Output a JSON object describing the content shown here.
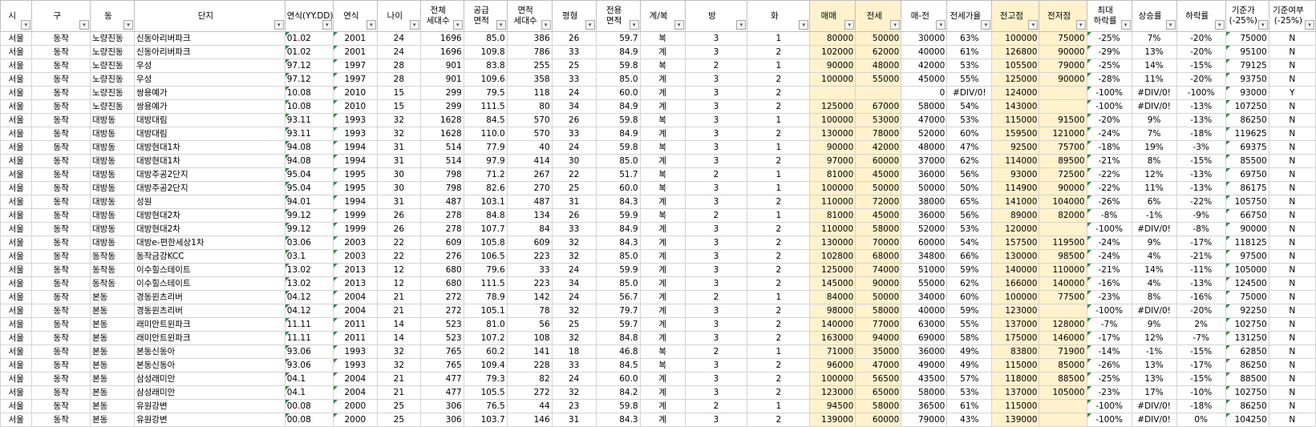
{
  "headers": [
    "시",
    "구",
    "동",
    "단지",
    "연식(YY.DD)",
    "연식",
    "나이",
    "전체\n세대수",
    "공급\n면적",
    "면적\n세대수",
    "평형",
    "전용\n면적",
    "계/복",
    "방",
    "화",
    "매매",
    "전세",
    "매-전",
    "전세가율",
    "전고점",
    "전저점",
    "최대\n하락률",
    "상승률",
    "하락률",
    "기준가\n(-25%)",
    "기준여부\n(-25%)"
  ],
  "rows": [
    [
      "서울",
      "동작",
      "노량진동",
      "신동아리버파크",
      "01.02",
      "2001",
      "24",
      "1696",
      "85.0",
      "386",
      "26",
      "59.7",
      "복",
      "3",
      "1",
      "80000",
      "50000",
      "30000",
      "63%",
      "100000",
      "75000",
      "-25%",
      "7%",
      "-20%",
      "75000",
      "N"
    ],
    [
      "서울",
      "동작",
      "노량진동",
      "신동아리버파크",
      "01.02",
      "2001",
      "24",
      "1696",
      "109.8",
      "786",
      "33",
      "84.9",
      "계",
      "3",
      "2",
      "102000",
      "62000",
      "40000",
      "61%",
      "126800",
      "90000",
      "-29%",
      "13%",
      "-20%",
      "95100",
      "N"
    ],
    [
      "서울",
      "동작",
      "노량진동",
      "우성",
      "97.12",
      "1997",
      "28",
      "901",
      "83.8",
      "255",
      "25",
      "59.8",
      "복",
      "2",
      "1",
      "90000",
      "48000",
      "42000",
      "53%",
      "105500",
      "79000",
      "-25%",
      "14%",
      "-15%",
      "79125",
      "N"
    ],
    [
      "서울",
      "동작",
      "노량진동",
      "우성",
      "97.12",
      "1997",
      "28",
      "901",
      "109.6",
      "358",
      "33",
      "85.0",
      "계",
      "3",
      "2",
      "100000",
      "55000",
      "45000",
      "55%",
      "125000",
      "90000",
      "-28%",
      "11%",
      "-20%",
      "93750",
      "N"
    ],
    [
      "서울",
      "동작",
      "노량진동",
      "쌍용예가",
      "10.08",
      "2010",
      "15",
      "299",
      "79.5",
      "118",
      "24",
      "60.0",
      "계",
      "3",
      "2",
      "",
      "",
      "0",
      "#DIV/0!",
      "124000",
      "",
      "-100%",
      "#DIV/0!",
      "-100%",
      "93000",
      "Y"
    ],
    [
      "서울",
      "동작",
      "노량진동",
      "쌍용예가",
      "10.08",
      "2010",
      "15",
      "299",
      "111.5",
      "80",
      "34",
      "84.9",
      "계",
      "3",
      "2",
      "125000",
      "67000",
      "58000",
      "54%",
      "143000",
      "",
      "-100%",
      "#DIV/0!",
      "-13%",
      "107250",
      "N"
    ],
    [
      "서울",
      "동작",
      "대방동",
      "대방대림",
      "93.11",
      "1993",
      "32",
      "1628",
      "84.5",
      "570",
      "26",
      "59.8",
      "복",
      "3",
      "1",
      "100000",
      "53000",
      "47000",
      "53%",
      "115000",
      "91500",
      "-20%",
      "9%",
      "-13%",
      "86250",
      "N"
    ],
    [
      "서울",
      "동작",
      "대방동",
      "대방대림",
      "93.11",
      "1993",
      "32",
      "1628",
      "110.0",
      "570",
      "33",
      "84.9",
      "계",
      "3",
      "2",
      "130000",
      "78000",
      "52000",
      "60%",
      "159500",
      "121000",
      "-24%",
      "7%",
      "-18%",
      "119625",
      "N"
    ],
    [
      "서울",
      "동작",
      "대방동",
      "대방현대1차",
      "94.08",
      "1994",
      "31",
      "514",
      "77.9",
      "40",
      "24",
      "59.8",
      "복",
      "3",
      "1",
      "90000",
      "42000",
      "48000",
      "47%",
      "92500",
      "75700",
      "-18%",
      "19%",
      "-3%",
      "69375",
      "N"
    ],
    [
      "서울",
      "동작",
      "대방동",
      "대방현대1차",
      "94.08",
      "1994",
      "31",
      "514",
      "97.9",
      "414",
      "30",
      "85.0",
      "계",
      "3",
      "2",
      "97000",
      "60000",
      "37000",
      "62%",
      "114000",
      "89500",
      "-21%",
      "8%",
      "-15%",
      "85500",
      "N"
    ],
    [
      "서울",
      "동작",
      "대방동",
      "대방주공2단지",
      "95.04",
      "1995",
      "30",
      "798",
      "71.2",
      "267",
      "22",
      "51.7",
      "복",
      "2",
      "1",
      "81000",
      "45000",
      "36000",
      "56%",
      "93000",
      "72500",
      "-22%",
      "12%",
      "-13%",
      "69750",
      "N"
    ],
    [
      "서울",
      "동작",
      "대방동",
      "대방주공2단지",
      "95.04",
      "1995",
      "30",
      "798",
      "82.6",
      "270",
      "25",
      "60.0",
      "복",
      "3",
      "1",
      "100000",
      "50000",
      "50000",
      "50%",
      "114900",
      "90000",
      "-22%",
      "11%",
      "-13%",
      "86175",
      "N"
    ],
    [
      "서울",
      "동작",
      "대방동",
      "성원",
      "94.01",
      "1994",
      "31",
      "487",
      "103.1",
      "487",
      "31",
      "84.3",
      "계",
      "3",
      "2",
      "110000",
      "72000",
      "38000",
      "65%",
      "141000",
      "104000",
      "-26%",
      "6%",
      "-22%",
      "105750",
      "N"
    ],
    [
      "서울",
      "동작",
      "대방동",
      "대방현대2차",
      "99.12",
      "1999",
      "26",
      "278",
      "84.8",
      "134",
      "26",
      "59.9",
      "복",
      "2",
      "1",
      "81000",
      "45000",
      "36000",
      "56%",
      "89000",
      "82000",
      "-8%",
      "-1%",
      "-9%",
      "66750",
      "N"
    ],
    [
      "서울",
      "동작",
      "대방동",
      "대방현대2차",
      "99.12",
      "1999",
      "26",
      "278",
      "107.7",
      "84",
      "33",
      "84.9",
      "계",
      "3",
      "2",
      "110000",
      "58000",
      "52000",
      "53%",
      "120000",
      "",
      "-100%",
      "#DIV/0!",
      "-8%",
      "90000",
      "N"
    ],
    [
      "서울",
      "동작",
      "대방동",
      "대방e-편한세상1차",
      "03.06",
      "2003",
      "22",
      "609",
      "105.8",
      "609",
      "32",
      "84.3",
      "계",
      "3",
      "2",
      "130000",
      "70000",
      "60000",
      "54%",
      "157500",
      "119500",
      "-24%",
      "9%",
      "-17%",
      "118125",
      "N"
    ],
    [
      "서울",
      "동작",
      "동작동",
      "동작금강KCC",
      "03.1",
      "2003",
      "22",
      "276",
      "106.5",
      "223",
      "32",
      "85.0",
      "계",
      "3",
      "2",
      "102800",
      "68000",
      "34800",
      "66%",
      "130000",
      "98500",
      "-24%",
      "4%",
      "-21%",
      "97500",
      "N"
    ],
    [
      "서울",
      "동작",
      "동작동",
      "이수힐스테이트",
      "13.02",
      "2013",
      "12",
      "680",
      "79.6",
      "33",
      "24",
      "59.9",
      "계",
      "3",
      "2",
      "125000",
      "74000",
      "51000",
      "59%",
      "140000",
      "110000",
      "-21%",
      "14%",
      "-11%",
      "105000",
      "N"
    ],
    [
      "서울",
      "동작",
      "동작동",
      "이수힐스테이트",
      "13.02",
      "2013",
      "12",
      "680",
      "111.5",
      "223",
      "34",
      "85.0",
      "계",
      "3",
      "2",
      "145000",
      "90000",
      "55000",
      "62%",
      "166000",
      "140000",
      "-16%",
      "4%",
      "-13%",
      "124500",
      "N"
    ],
    [
      "서울",
      "동작",
      "본동",
      "경동윈츠리버",
      "04.12",
      "2004",
      "21",
      "272",
      "78.9",
      "142",
      "24",
      "56.7",
      "계",
      "2",
      "1",
      "84000",
      "50000",
      "34000",
      "60%",
      "100000",
      "77500",
      "-23%",
      "8%",
      "-16%",
      "75000",
      "N"
    ],
    [
      "서울",
      "동작",
      "본동",
      "경동윈츠리버",
      "04.12",
      "2004",
      "21",
      "272",
      "105.1",
      "78",
      "32",
      "79.7",
      "계",
      "3",
      "2",
      "98000",
      "58000",
      "40000",
      "59%",
      "123000",
      "",
      "-100%",
      "#DIV/0!",
      "-20%",
      "92250",
      "N"
    ],
    [
      "서울",
      "동작",
      "본동",
      "래미안트윈파크",
      "11.11",
      "2011",
      "14",
      "523",
      "81.0",
      "56",
      "25",
      "59.7",
      "계",
      "3",
      "2",
      "140000",
      "77000",
      "63000",
      "55%",
      "137000",
      "128000",
      "-7%",
      "9%",
      "2%",
      "102750",
      "N"
    ],
    [
      "서울",
      "동작",
      "본동",
      "래미안트윈파크",
      "11.11",
      "2011",
      "14",
      "523",
      "107.2",
      "108",
      "32",
      "84.8",
      "계",
      "3",
      "2",
      "163000",
      "94000",
      "69000",
      "58%",
      "175000",
      "146000",
      "-17%",
      "12%",
      "-7%",
      "131250",
      "N"
    ],
    [
      "서울",
      "동작",
      "본동",
      "본동신동아",
      "93.06",
      "1993",
      "32",
      "765",
      "60.2",
      "141",
      "18",
      "46.8",
      "복",
      "2",
      "1",
      "71000",
      "35000",
      "36000",
      "49%",
      "83800",
      "71900",
      "-14%",
      "-1%",
      "-15%",
      "62850",
      "N"
    ],
    [
      "서울",
      "동작",
      "본동",
      "본동신동아",
      "93.06",
      "1993",
      "32",
      "765",
      "109.4",
      "228",
      "33",
      "84.5",
      "복",
      "3",
      "2",
      "96000",
      "47000",
      "49000",
      "49%",
      "115000",
      "85000",
      "-26%",
      "13%",
      "-17%",
      "86250",
      "N"
    ],
    [
      "서울",
      "동작",
      "본동",
      "삼성래미안",
      "04.1",
      "2004",
      "21",
      "477",
      "79.3",
      "82",
      "24",
      "60.0",
      "계",
      "3",
      "2",
      "100000",
      "56500",
      "43500",
      "57%",
      "118000",
      "88500",
      "-25%",
      "13%",
      "-15%",
      "88500",
      "N"
    ],
    [
      "서울",
      "동작",
      "본동",
      "삼성래미안",
      "04.1",
      "2004",
      "21",
      "477",
      "105.5",
      "272",
      "32",
      "84.2",
      "계",
      "3",
      "2",
      "123000",
      "65000",
      "58000",
      "53%",
      "137000",
      "105000",
      "-23%",
      "17%",
      "-10%",
      "102750",
      "N"
    ],
    [
      "서울",
      "동작",
      "본동",
      "유원강변",
      "00.08",
      "2000",
      "25",
      "306",
      "76.5",
      "44",
      "23",
      "59.8",
      "계",
      "2",
      "1",
      "94500",
      "58000",
      "36500",
      "61%",
      "115000",
      "",
      "-100%",
      "#DIV/0!",
      "-18%",
      "86250",
      "N"
    ],
    [
      "서울",
      "동작",
      "본동",
      "유원강변",
      "00.08",
      "2000",
      "25",
      "306",
      "103.7",
      "146",
      "31",
      "84.3",
      "계",
      "3",
      "2",
      "139000",
      "60000",
      "79000",
      "43%",
      "139000",
      "",
      "-100%",
      "#DIV/0!",
      "0%",
      "104250",
      "N"
    ]
  ]
}
